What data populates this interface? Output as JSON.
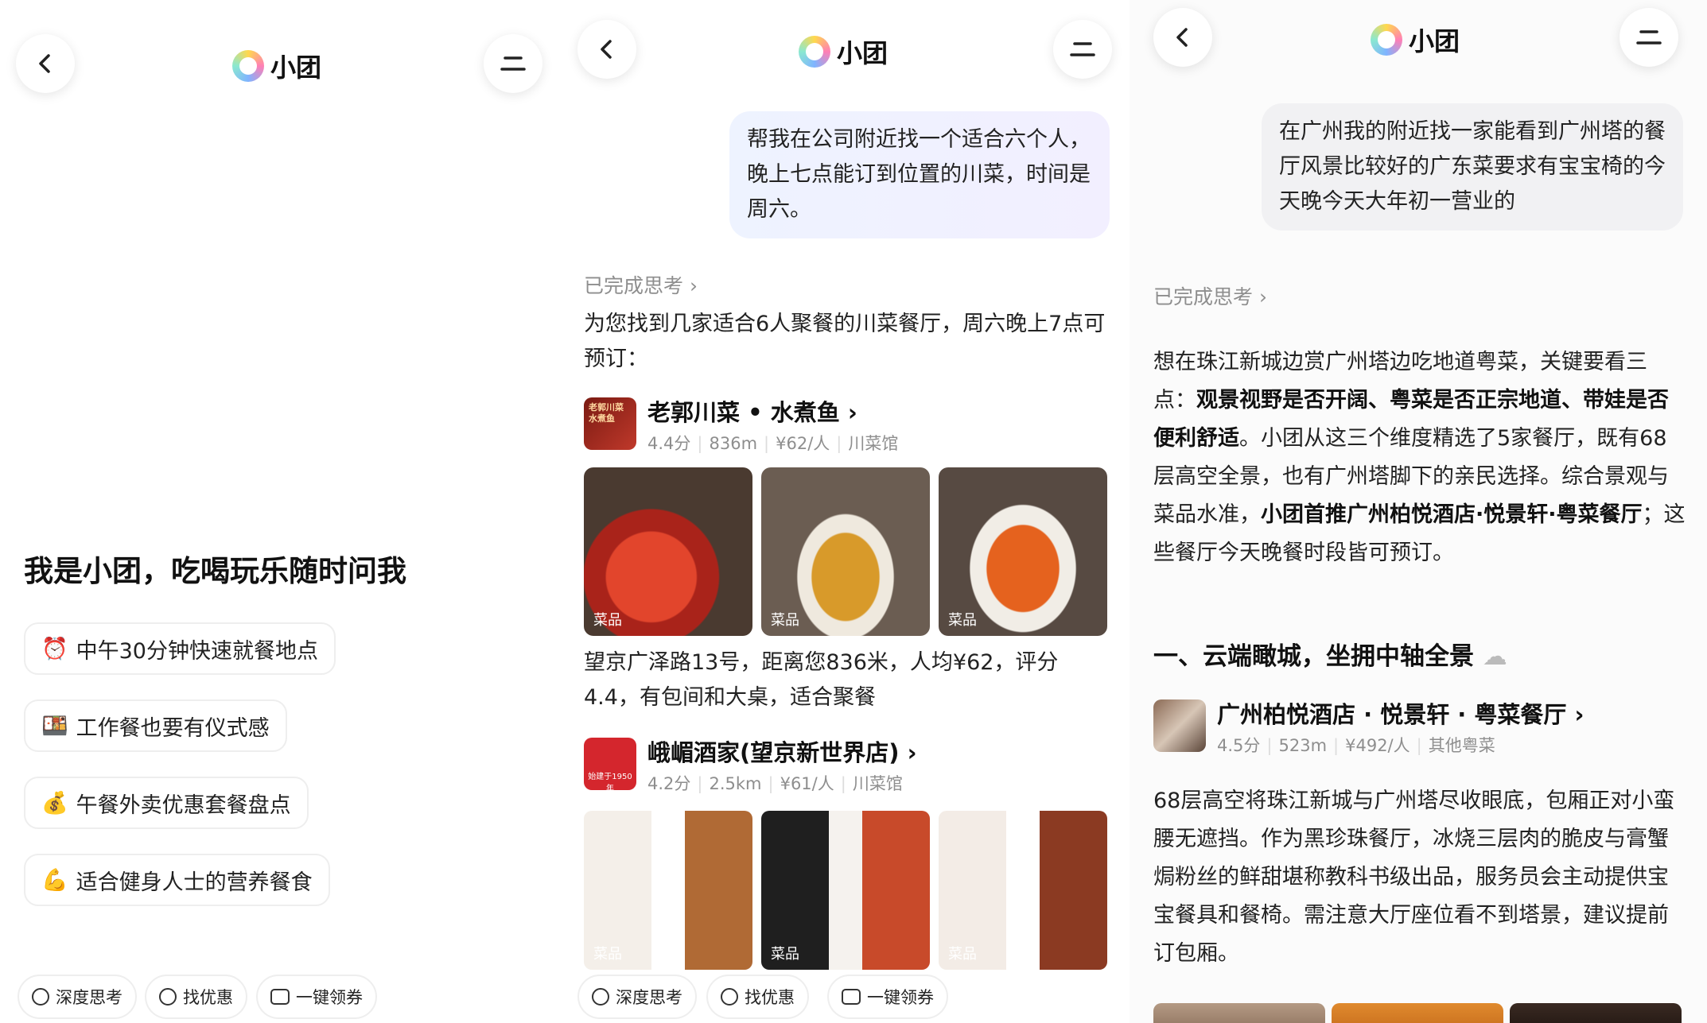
{
  "header": {
    "title": "小团"
  },
  "panel1": {
    "greeting": "我是小团，吃喝玩乐随时问我",
    "suggestions": [
      {
        "emoji": "⏰",
        "icon": "alarm-clock-icon",
        "text": "中午30分钟快速就餐地点"
      },
      {
        "emoji": "🍱",
        "icon": "bento-icon",
        "text": "工作餐也要有仪式感"
      },
      {
        "emoji": "💰",
        "icon": "money-bag-icon",
        "text": "午餐外卖优惠套餐盘点"
      },
      {
        "emoji": "💪",
        "icon": "flexed-biceps-icon",
        "text": "适合健身人士的营养餐食"
      }
    ]
  },
  "toolbar": {
    "deep_think": "深度思考",
    "find_deals": "找优惠",
    "coupons": "一键领券"
  },
  "panel2": {
    "query": "帮我在公司附近找一个适合六个人，晚上七点能订到位置的川菜，时间是周六。",
    "thinking_done": "已完成思考",
    "intro": "为您找到几家适合6人聚餐的川菜餐厅，周六晚上7点可预订：",
    "restaurant1": {
      "name": "老郭川菜 • 水煮鱼",
      "rating": "4.4分",
      "distance": "836m",
      "price": "¥62/人",
      "category": "川菜馆",
      "dish_label": "菜品",
      "thumb_text": "老郭川菜 水煮鱼",
      "desc": "望京广泽路13号，距离您836米，人均¥62，评分4.4，有包间和大桌，适合聚餐"
    },
    "restaurant2": {
      "name": "峨嵋酒家(望京新世界店)",
      "rating": "4.2分",
      "distance": "2.5km",
      "price": "¥61/人",
      "category": "川菜馆",
      "dish_label": "菜品",
      "thumb_text": "始建于1950年"
    }
  },
  "panel3": {
    "query": "在广州我的附近找一家能看到广州塔的餐厅风景比较好的广东菜要求有宝宝椅的今天晚今天大年初一营业的",
    "thinking_done": "已完成思考",
    "intro_a": "想在珠江新城边赏广州塔边吃地道粤菜，关键要看三点：",
    "intro_b": "观景视野是否开阔、粤菜是否正宗地道、带娃是否便利舒适",
    "intro_c": "。小团从这三个维度精选了5家餐厅，既有68层高空全景，也有广州塔脚下的亲民选择。综合景观与菜品水准，",
    "intro_d": "小团首推广州柏悦酒店·悦景轩·粤菜餐厅",
    "intro_e": "；这些餐厅今天晚餐时段皆可预订。",
    "section_title": "一、云端瞰城，坐拥中轴全景",
    "restaurant": {
      "name": "广州柏悦酒店 · 悦景轩 · 粤菜餐厅",
      "rating": "4.5分",
      "distance": "523m",
      "price": "¥492/人",
      "category": "其他粤菜"
    },
    "desc": "68层高空将珠江新城与广州塔尽收眼底，包厢正对小蛮腰无遮挡。作为黑珍珠餐厅，冰烧三层肉的脆皮与膏蟹焗粉丝的鲜甜堪称教科书级出品，服务员会主动提供宝宝餐具和餐椅。需注意大厅座位看不到塔景，建议提前订包厢。"
  }
}
